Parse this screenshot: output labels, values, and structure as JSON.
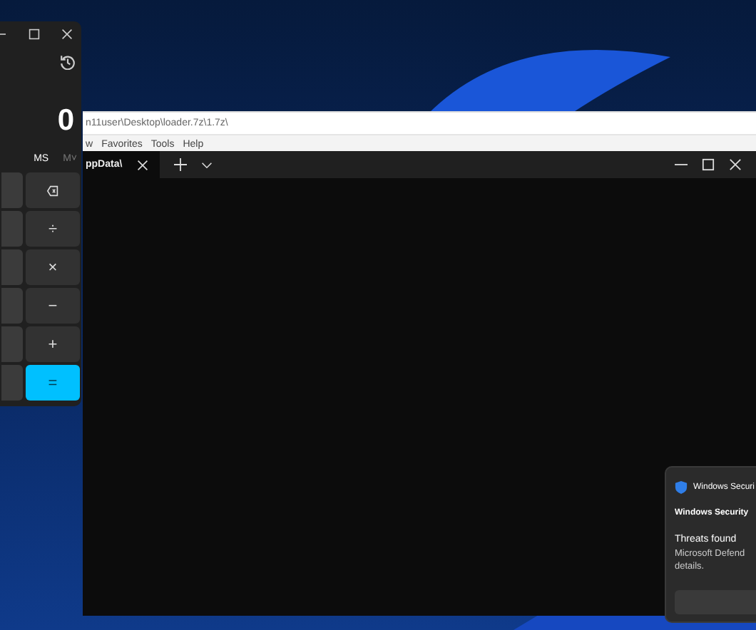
{
  "calculator": {
    "display": "0",
    "memory": [
      {
        "label": "MS",
        "disabled": false
      },
      {
        "label": "M˅",
        "disabled": true
      }
    ],
    "keys": [
      {
        "kind": "blank"
      },
      {
        "kind": "icon"
      },
      {
        "kind": "blank"
      },
      {
        "kind": "text",
        "label": "÷"
      },
      {
        "kind": "blank"
      },
      {
        "kind": "text",
        "label": "×"
      },
      {
        "kind": "blank"
      },
      {
        "kind": "text",
        "label": "−"
      },
      {
        "kind": "blank"
      },
      {
        "kind": "text",
        "label": "+"
      },
      {
        "kind": "blank"
      },
      {
        "kind": "accent",
        "label": "="
      }
    ]
  },
  "explorer": {
    "address": "n11user\\Desktop\\loader.7z\\1.7z\\",
    "menu": [
      "w",
      "Favorites",
      "Tools",
      "Help"
    ]
  },
  "terminal": {
    "tabs": [
      {
        "label": "ppData\\",
        "selected": true
      }
    ]
  },
  "notification": {
    "app": "Windows Securi",
    "header": "Windows Security",
    "title": "Threats found",
    "body_lines": [
      "Microsoft Defend",
      "details."
    ]
  }
}
